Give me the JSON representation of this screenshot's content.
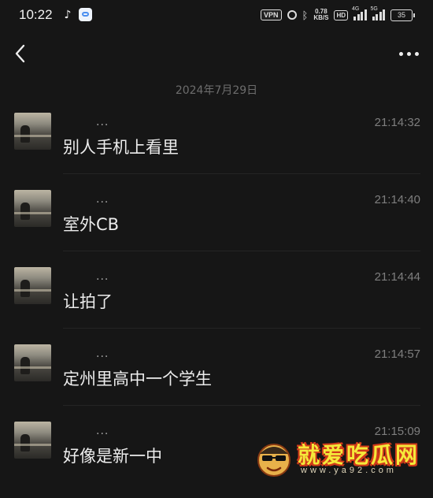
{
  "status_bar": {
    "time": "10:22",
    "vpn": "VPN",
    "net_speed_value": "0.78",
    "net_speed_unit": "KB/S",
    "hd": "HD",
    "signal1_label": "4G",
    "signal2_label": "5G",
    "battery": "35",
    "icons": [
      "tiktok-icon",
      "app-icon",
      "vpn-icon",
      "alarm-icon",
      "bluetooth-icon",
      "signal-icon",
      "battery-icon"
    ]
  },
  "header": {
    "back_icon": "chevron-left-icon",
    "more_icon": "more-dots-icon"
  },
  "date_label": "2024年7月29日",
  "messages": [
    {
      "sender": "...",
      "time": "21:14:32",
      "text": "别人手机上看里"
    },
    {
      "sender": "...",
      "time": "21:14:40",
      "text": "室外CB"
    },
    {
      "sender": "...",
      "time": "21:14:44",
      "text": "让拍了"
    },
    {
      "sender": "...",
      "time": "21:14:57",
      "text": "定州里高中一个学生"
    },
    {
      "sender": "...",
      "time": "21:15:09",
      "text": "好像是新一中"
    }
  ],
  "watermark": {
    "title": "就爱吃瓜网",
    "url": "www.ya92.com"
  }
}
